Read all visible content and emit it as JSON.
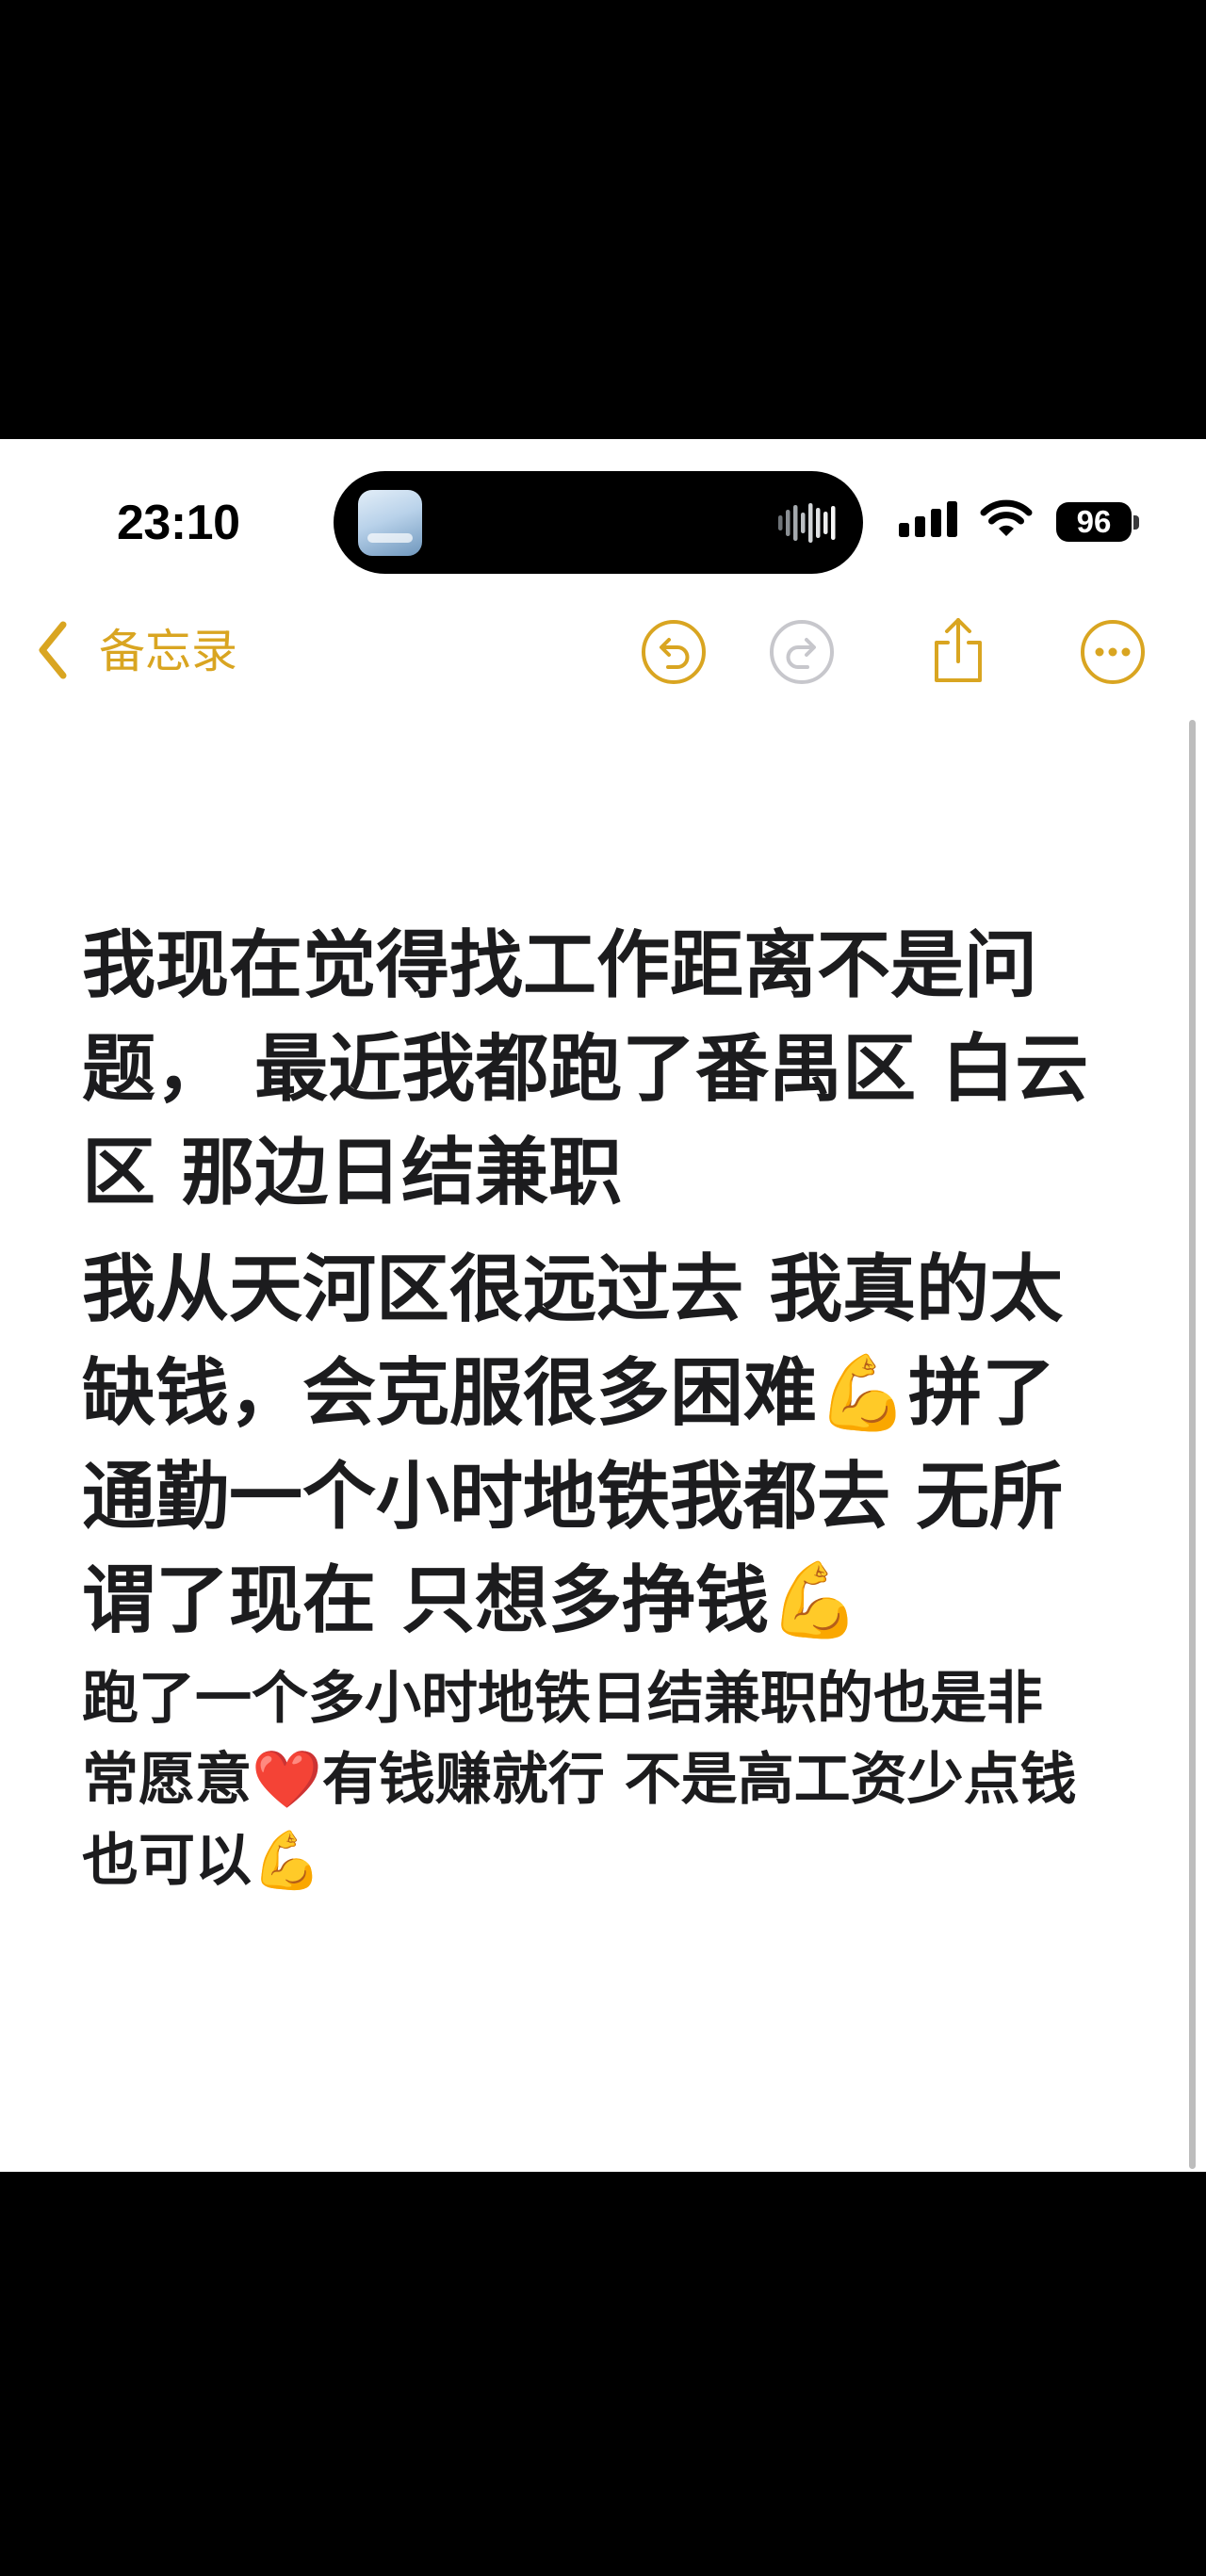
{
  "status_bar": {
    "time": "23:10",
    "battery": "96",
    "icons": [
      "signal-icon",
      "wifi-icon",
      "battery-icon"
    ]
  },
  "dynamic_island": {
    "icons": [
      "album-art",
      "audio-waveform-icon"
    ]
  },
  "nav": {
    "back_label": "备忘录",
    "icons": [
      "chevron-left-icon",
      "undo-icon",
      "redo-icon",
      "share-icon",
      "more-icon"
    ]
  },
  "colors": {
    "accent": "#D9A521",
    "text": "#1C1C1E",
    "disabled": "#C7C7CC"
  },
  "note": {
    "paragraphs": [
      {
        "lines": [
          "我现在觉得找工作距离不是问",
          "题， 最近我都跑了番禺区 白云",
          "区 那边日结兼职"
        ]
      },
      {
        "lines": [
          "我从天河区很远过去 我真的太",
          "缺钱，会克服很多困难💪拼了",
          "通勤一个小时地铁我都去 无所",
          "谓了现在 只想多挣钱💪"
        ]
      },
      {
        "lines": [
          "跑了一个多小时地铁日结兼职的也是非",
          "常愿意❤️有钱赚就行 不是高工资少点钱",
          "也可以💪"
        ]
      }
    ]
  }
}
